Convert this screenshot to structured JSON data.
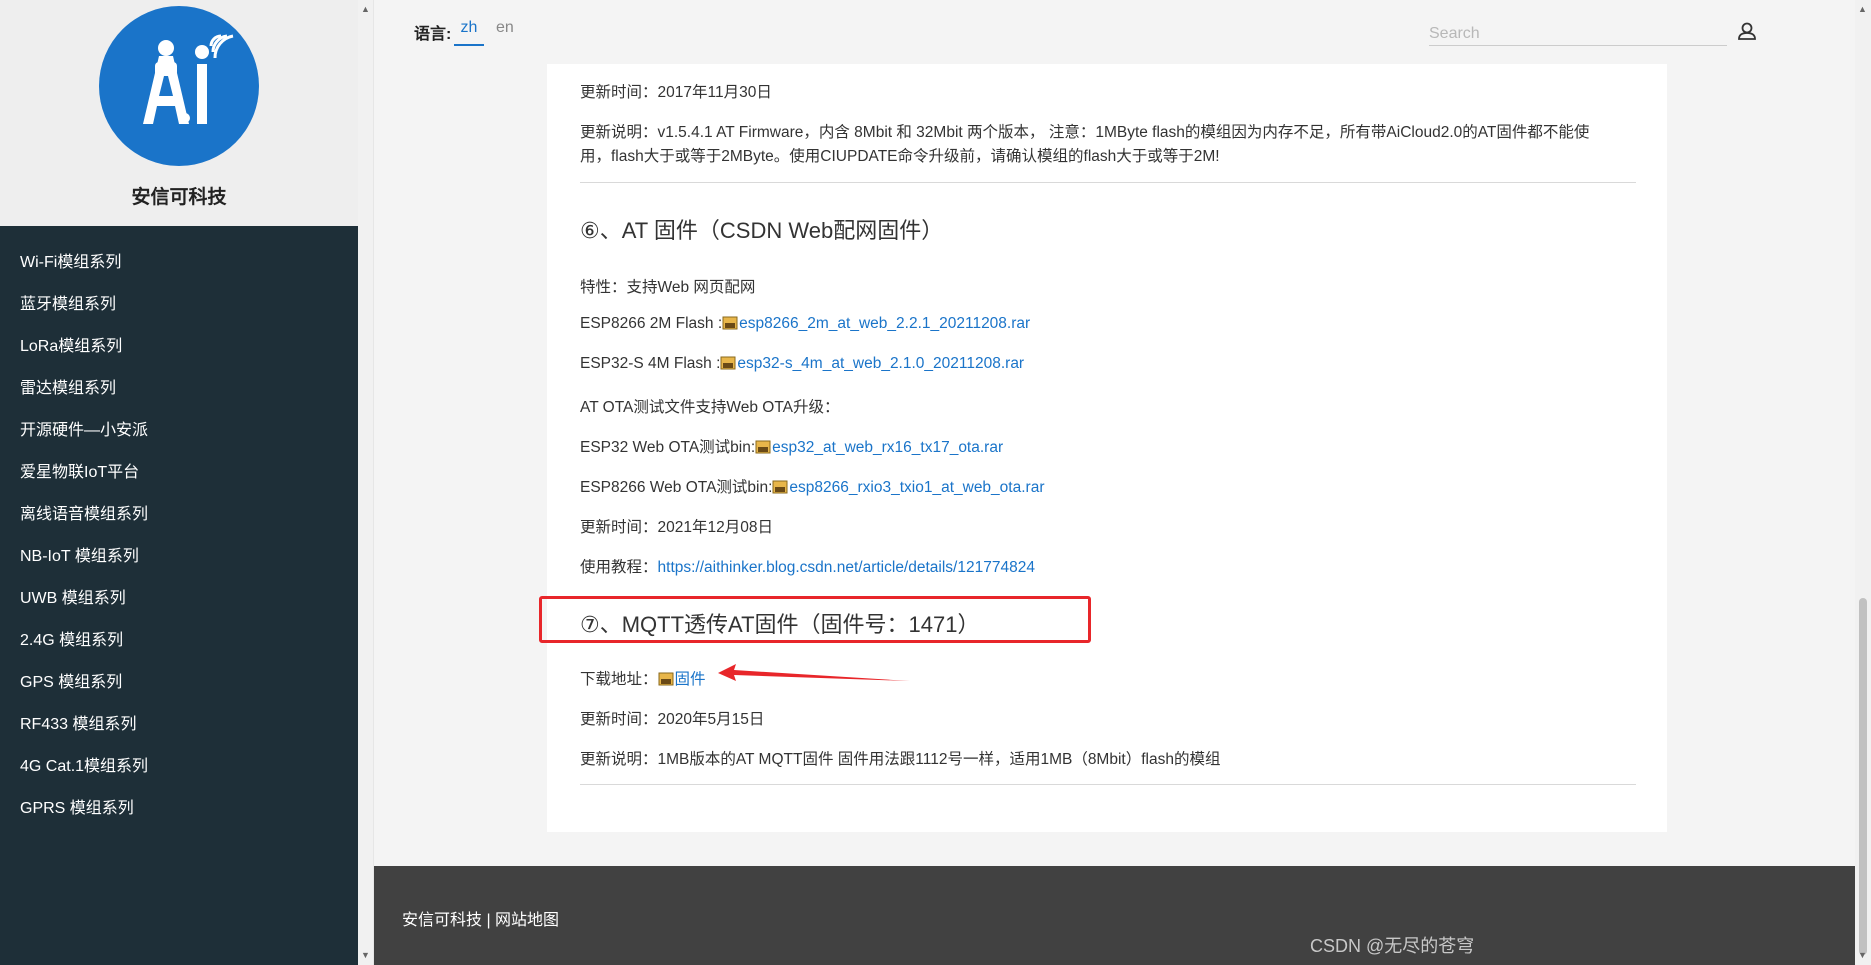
{
  "sidebar": {
    "brand": "安信可科技",
    "items": [
      {
        "label": "Wi-Fi模组系列"
      },
      {
        "label": "蓝牙模组系列"
      },
      {
        "label": "LoRa模组系列"
      },
      {
        "label": "雷达模组系列"
      },
      {
        "label": "开源硬件—小安派"
      },
      {
        "label": "爱星物联IoT平台"
      },
      {
        "label": "离线语音模组系列"
      },
      {
        "label": "NB-IoT 模组系列"
      },
      {
        "label": "UWB 模组系列"
      },
      {
        "label": "2.4G 模组系列"
      },
      {
        "label": "GPS 模组系列"
      },
      {
        "label": "RF433 模组系列"
      },
      {
        "label": "4G Cat.1模组系列"
      },
      {
        "label": "GPRS 模组系列"
      }
    ]
  },
  "header": {
    "lang_label": "语言:",
    "lang_options": [
      "zh",
      "en"
    ],
    "lang_selected": "zh",
    "search_placeholder": "Search"
  },
  "content": {
    "prev_update_time": "更新时间：2017年11月30日",
    "prev_note_line1": "更新说明：v1.5.4.1 AT Firmware，内含 8Mbit 和 32Mbit 两个版本，  注意：1MByte flash的模组因为内存不足，所有带AiCloud2.0的AT固件都不能使",
    "prev_note_line2": "用，flash大于或等于2MByte。使用CIUPDATE命令升级前，请确认模组的flash大于或等于2M!",
    "section6": {
      "title": "⑥、AT 固件（CSDN Web配网固件）",
      "feature": "特性：支持Web 网页配网",
      "esp8266_label": "ESP8266 2M Flash :",
      "esp8266_link": "esp8266_2m_at_web_2.2.1_20211208.rar",
      "esp32_label": "ESP32-S 4M Flash :",
      "esp32_link": "esp32-s_4m_at_web_2.1.0_20211208.rar",
      "ota_desc": "AT OTA测试文件支持Web OTA升级：",
      "esp32_ota_label": "ESP32 Web OTA测试bin:",
      "esp32_ota_link": "esp32_at_web_rx16_tx17_ota.rar",
      "esp8266_ota_label": "ESP8266 Web OTA测试bin:",
      "esp8266_ota_link": "esp8266_rxio3_txio1_at_web_ota.rar",
      "update_time": "更新时间：2021年12月08日",
      "tutorial_label": "使用教程：",
      "tutorial_link": "https://aithinker.blog.csdn.net/article/details/121774824"
    },
    "section7": {
      "title": "⑦、MQTT透传AT固件（固件号：1471）",
      "download_label": "下载地址：",
      "download_link": "固件",
      "update_time": "更新时间：2020年5月15日",
      "note": "更新说明：1MB版本的AT MQTT固件 固件用法跟1112号一样，适用1MB（8Mbit）flash的模组"
    }
  },
  "footer": {
    "links": "安信可科技 | 网站地图"
  },
  "watermark": "CSDN @无尽的苍穹",
  "colors": {
    "sidebar_bg": "#1e2f38",
    "accent": "#1a74c9",
    "highlight_red": "#e8262a",
    "footer_bg": "#414141"
  }
}
